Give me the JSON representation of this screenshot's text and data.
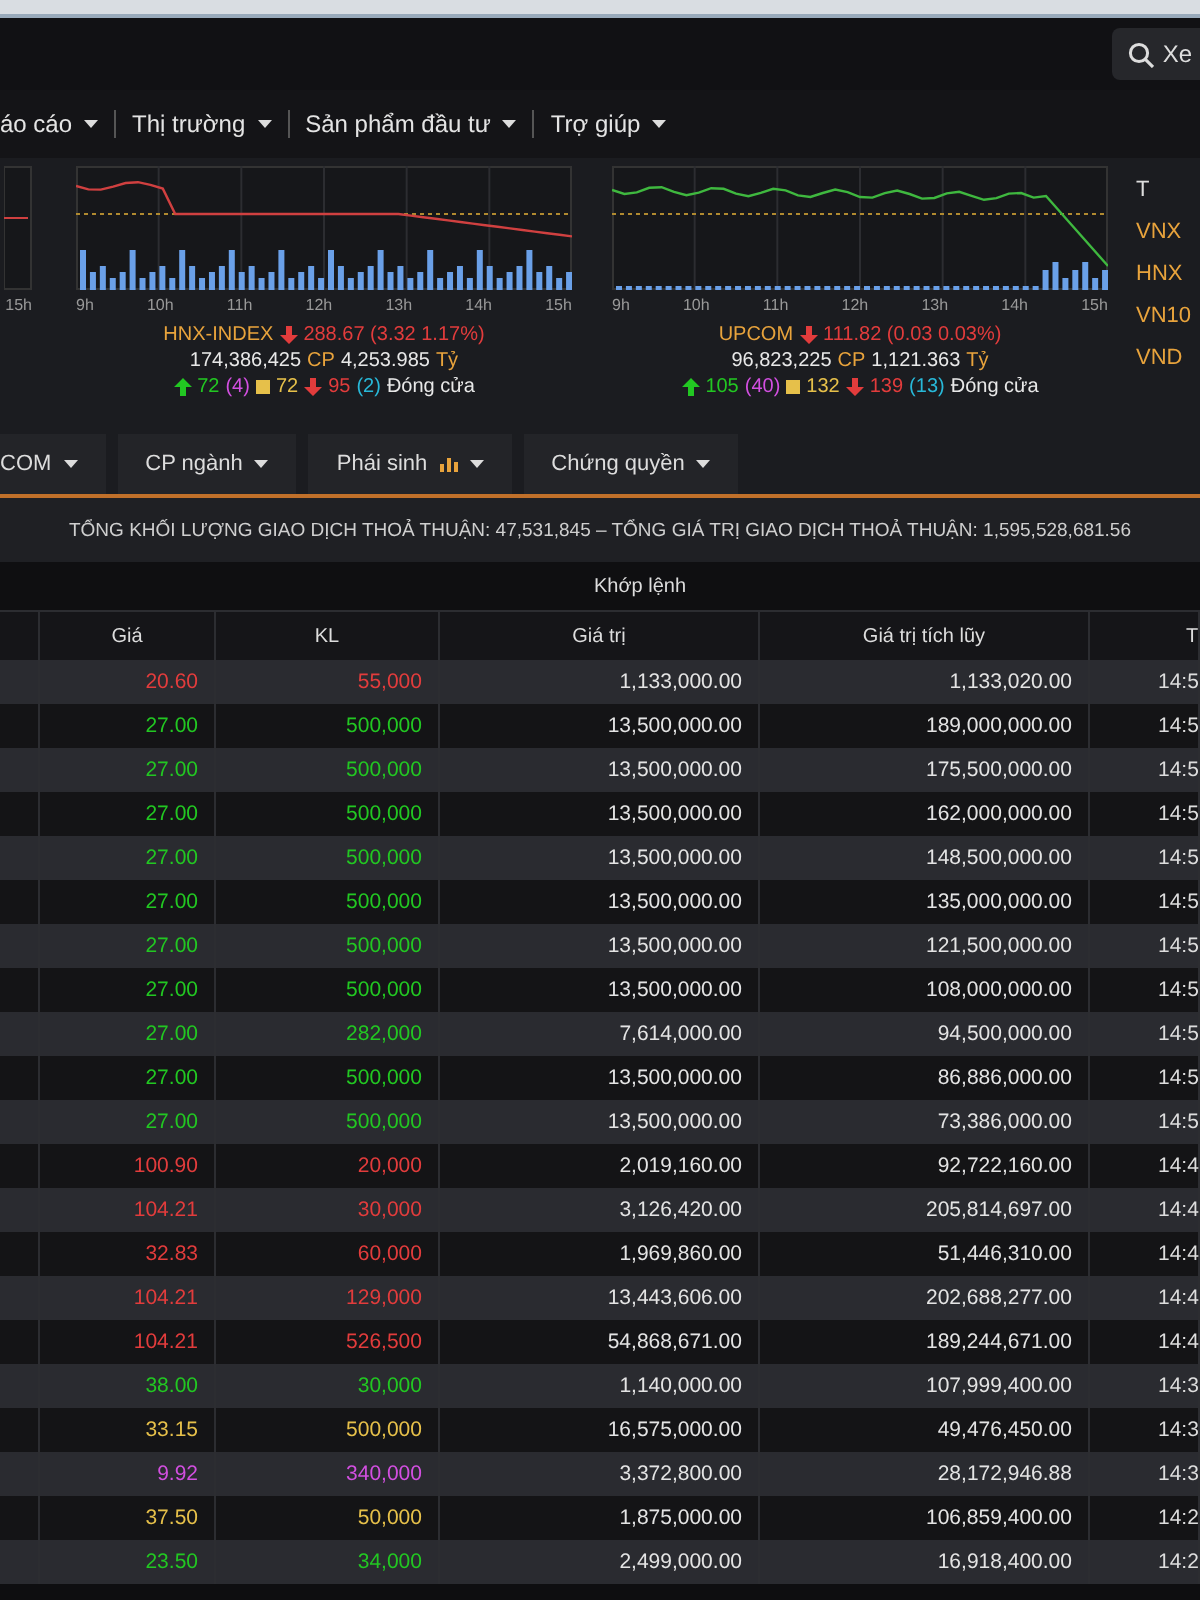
{
  "header": {
    "search_button": "Xe"
  },
  "nav": {
    "items": [
      {
        "label": "áo cáo"
      },
      {
        "label": "Thị trường"
      },
      {
        "label": "Sản phẩm đầu tư"
      },
      {
        "label": "Trợ giúp"
      }
    ]
  },
  "left_chart": {
    "time_labels": [
      "15h"
    ]
  },
  "index_panels": [
    {
      "name": "HNX-INDEX",
      "change": "288.67 (3.32 1.17%)",
      "volume": "174,386,425",
      "volume_unit": "CP",
      "value": "4,253.985",
      "value_unit": "Tỷ",
      "advances": "72",
      "ceiling": "(4)",
      "unchanged": "72",
      "declines": "95",
      "floor": "(2)",
      "status": "Đóng cửa",
      "time_labels": [
        "9h",
        "10h",
        "11h",
        "12h",
        "13h",
        "14h",
        "15h"
      ]
    },
    {
      "name": "UPCOM",
      "change": "111.82 (0.03 0.03%)",
      "volume": "96,823,225",
      "volume_unit": "CP",
      "value": "1,121.363",
      "value_unit": "Tỷ",
      "advances": "105",
      "ceiling": "(40)",
      "unchanged": "132",
      "declines": "139",
      "floor": "(13)",
      "status": "Đóng cửa",
      "time_labels": [
        "9h",
        "10h",
        "11h",
        "12h",
        "13h",
        "14h",
        "15h"
      ]
    }
  ],
  "index_list": {
    "header": "T",
    "items": [
      "VNX",
      "HNX",
      "VN10",
      "VND"
    ]
  },
  "tabs": [
    {
      "label": "COM",
      "has_icon": false
    },
    {
      "label": "CP ngành",
      "has_icon": false
    },
    {
      "label": "Phái sinh",
      "has_icon": true
    },
    {
      "label": "Chứng quyền",
      "has_icon": false
    }
  ],
  "summary": "TỔNG KHỐI LƯỢNG GIAO DỊCH THOẢ THUẬN: 47,531,845 – TỔNG GIÁ TRỊ GIAO DỊCH THOẢ THUẬN: 1,595,528,681.56",
  "table": {
    "group_header": "Khớp lệnh",
    "columns": [
      "Giá",
      "KL",
      "Giá trị",
      "Giá trị tích lũy",
      "T"
    ],
    "rows": [
      {
        "price": "20.60",
        "volume": "55,000",
        "value": "1,133,000.00",
        "cumulative": "1,133,020.00",
        "time": "14:5",
        "color": "#e23c3c"
      },
      {
        "price": "27.00",
        "volume": "500,000",
        "value": "13,500,000.00",
        "cumulative": "189,000,000.00",
        "time": "14:5",
        "color": "#22c722"
      },
      {
        "price": "27.00",
        "volume": "500,000",
        "value": "13,500,000.00",
        "cumulative": "175,500,000.00",
        "time": "14:5",
        "color": "#22c722"
      },
      {
        "price": "27.00",
        "volume": "500,000",
        "value": "13,500,000.00",
        "cumulative": "162,000,000.00",
        "time": "14:5",
        "color": "#22c722"
      },
      {
        "price": "27.00",
        "volume": "500,000",
        "value": "13,500,000.00",
        "cumulative": "148,500,000.00",
        "time": "14:5",
        "color": "#22c722"
      },
      {
        "price": "27.00",
        "volume": "500,000",
        "value": "13,500,000.00",
        "cumulative": "135,000,000.00",
        "time": "14:5",
        "color": "#22c722"
      },
      {
        "price": "27.00",
        "volume": "500,000",
        "value": "13,500,000.00",
        "cumulative": "121,500,000.00",
        "time": "14:5",
        "color": "#22c722"
      },
      {
        "price": "27.00",
        "volume": "500,000",
        "value": "13,500,000.00",
        "cumulative": "108,000,000.00",
        "time": "14:5",
        "color": "#22c722"
      },
      {
        "price": "27.00",
        "volume": "282,000",
        "value": "7,614,000.00",
        "cumulative": "94,500,000.00",
        "time": "14:5",
        "color": "#22c722"
      },
      {
        "price": "27.00",
        "volume": "500,000",
        "value": "13,500,000.00",
        "cumulative": "86,886,000.00",
        "time": "14:5",
        "color": "#22c722"
      },
      {
        "price": "27.00",
        "volume": "500,000",
        "value": "13,500,000.00",
        "cumulative": "73,386,000.00",
        "time": "14:5",
        "color": "#22c722"
      },
      {
        "price": "100.90",
        "volume": "20,000",
        "value": "2,019,160.00",
        "cumulative": "92,722,160.00",
        "time": "14:4",
        "color": "#e23c3c"
      },
      {
        "price": "104.21",
        "volume": "30,000",
        "value": "3,126,420.00",
        "cumulative": "205,814,697.00",
        "time": "14:4",
        "color": "#e23c3c"
      },
      {
        "price": "32.83",
        "volume": "60,000",
        "value": "1,969,860.00",
        "cumulative": "51,446,310.00",
        "time": "14:4",
        "color": "#e23c3c"
      },
      {
        "price": "104.21",
        "volume": "129,000",
        "value": "13,443,606.00",
        "cumulative": "202,688,277.00",
        "time": "14:4",
        "color": "#e23c3c"
      },
      {
        "price": "104.21",
        "volume": "526,500",
        "value": "54,868,671.00",
        "cumulative": "189,244,671.00",
        "time": "14:4",
        "color": "#e23c3c"
      },
      {
        "price": "38.00",
        "volume": "30,000",
        "value": "1,140,000.00",
        "cumulative": "107,999,400.00",
        "time": "14:3",
        "color": "#22c722"
      },
      {
        "price": "33.15",
        "volume": "500,000",
        "value": "16,575,000.00",
        "cumulative": "49,476,450.00",
        "time": "14:3",
        "color": "#e6c04a"
      },
      {
        "price": "9.92",
        "volume": "340,000",
        "value": "3,372,800.00",
        "cumulative": "28,172,946.88",
        "time": "14:3",
        "color": "#d24fe0"
      },
      {
        "price": "37.50",
        "volume": "50,000",
        "value": "1,875,000.00",
        "cumulative": "106,859,400.00",
        "time": "14:2",
        "color": "#e6c04a"
      },
      {
        "price": "23.50",
        "volume": "34,000",
        "value": "2,499,000.00",
        "cumulative": "16,918,400.00",
        "time": "14:2",
        "color": "#22c722"
      }
    ]
  }
}
